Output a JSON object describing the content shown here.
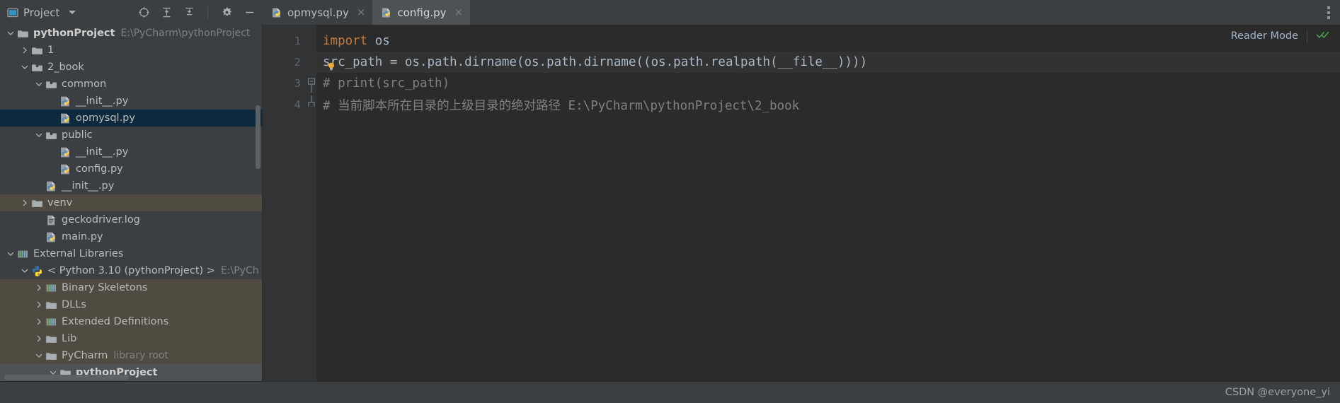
{
  "window": {
    "theme_bg": "#3c3f41",
    "editor_bg": "#2b2b2b",
    "accent_selection": "#0d293e",
    "library_bg": "#4f4b41"
  },
  "tool_window": {
    "title": "Project",
    "dropdown_icon": "chevron-down-icon",
    "actions": [
      {
        "name": "select-opened-file-icon",
        "tooltip": "Select Opened File"
      },
      {
        "name": "expand-all-icon",
        "tooltip": "Expand All"
      },
      {
        "name": "collapse-all-icon",
        "tooltip": "Collapse All"
      },
      {
        "name": "settings-gear-icon",
        "tooltip": "Settings"
      },
      {
        "name": "hide-icon",
        "tooltip": "Hide"
      }
    ]
  },
  "editor_tabs": [
    {
      "label": "opmysql.py",
      "icon": "python-file-icon",
      "active": false,
      "close_glyph": "×"
    },
    {
      "label": "config.py",
      "icon": "python-file-icon",
      "active": true,
      "close_glyph": "×"
    }
  ],
  "tabs_overflow_icon": "kebab-menu-icon",
  "reader_mode": {
    "label": "Reader Mode",
    "check_icon": "double-check-icon",
    "check_color": "#4e9a51"
  },
  "tree": [
    {
      "depth": 0,
      "arrow": "down",
      "icon": "folder-project",
      "label": "pythonProject",
      "sub": "E:\\PyCharm\\pythonProject",
      "bold": true,
      "state": "none"
    },
    {
      "depth": 1,
      "arrow": "right",
      "icon": "folder",
      "label": "1",
      "sub": "",
      "bold": false,
      "state": "none"
    },
    {
      "depth": 1,
      "arrow": "down",
      "icon": "folder-source",
      "label": "2_book",
      "sub": "",
      "bold": false,
      "state": "none"
    },
    {
      "depth": 2,
      "arrow": "down",
      "icon": "folder-source",
      "label": "common",
      "sub": "",
      "bold": false,
      "state": "none"
    },
    {
      "depth": 3,
      "arrow": "none",
      "icon": "python-file",
      "label": "__init__.py",
      "sub": "",
      "bold": false,
      "state": "none"
    },
    {
      "depth": 3,
      "arrow": "none",
      "icon": "python-file",
      "label": "opmysql.py",
      "sub": "",
      "bold": false,
      "state": "selected"
    },
    {
      "depth": 2,
      "arrow": "down",
      "icon": "folder-source",
      "label": "public",
      "sub": "",
      "bold": false,
      "state": "none"
    },
    {
      "depth": 3,
      "arrow": "none",
      "icon": "python-file",
      "label": "__init__.py",
      "sub": "",
      "bold": false,
      "state": "none"
    },
    {
      "depth": 3,
      "arrow": "none",
      "icon": "python-file",
      "label": "config.py",
      "sub": "",
      "bold": false,
      "state": "none"
    },
    {
      "depth": 2,
      "arrow": "none",
      "icon": "python-file",
      "label": "__init__.py",
      "sub": "",
      "bold": false,
      "state": "none"
    },
    {
      "depth": 1,
      "arrow": "right",
      "icon": "folder",
      "label": "venv",
      "sub": "",
      "bold": false,
      "state": "library"
    },
    {
      "depth": 2,
      "arrow": "none",
      "icon": "log-file",
      "label": "geckodriver.log",
      "sub": "",
      "bold": false,
      "state": "none"
    },
    {
      "depth": 2,
      "arrow": "none",
      "icon": "python-file",
      "label": "main.py",
      "sub": "",
      "bold": false,
      "state": "none"
    },
    {
      "depth": 0,
      "arrow": "down",
      "icon": "library-bars",
      "label": "External Libraries",
      "sub": "",
      "bold": false,
      "state": "none"
    },
    {
      "depth": 1,
      "arrow": "down",
      "icon": "python-logo",
      "label": "< Python 3.10 (pythonProject) >",
      "sub": "E:\\PyCh",
      "bold": false,
      "state": "none"
    },
    {
      "depth": 2,
      "arrow": "right",
      "icon": "library-bars",
      "label": "Binary Skeletons",
      "sub": "",
      "bold": false,
      "state": "library"
    },
    {
      "depth": 2,
      "arrow": "right",
      "icon": "folder",
      "label": "DLLs",
      "sub": "",
      "bold": false,
      "state": "library"
    },
    {
      "depth": 2,
      "arrow": "right",
      "icon": "library-bars",
      "label": "Extended Definitions",
      "sub": "",
      "bold": false,
      "state": "library"
    },
    {
      "depth": 2,
      "arrow": "right",
      "icon": "folder",
      "label": "Lib",
      "sub": "",
      "bold": false,
      "state": "library"
    },
    {
      "depth": 2,
      "arrow": "down",
      "icon": "folder",
      "label": "PyCharm",
      "sub": "library root",
      "bold": false,
      "state": "library"
    },
    {
      "depth": 3,
      "arrow": "down",
      "icon": "folder",
      "label": "pythonProject",
      "sub": "",
      "bold": true,
      "state": "grey"
    }
  ],
  "code": {
    "file": "config.py",
    "lines": [
      {
        "number": "1",
        "fold": "none",
        "caret": false,
        "tokens": [
          {
            "text": "import",
            "cls": "kw"
          },
          {
            "text": " os",
            "cls": "txt"
          }
        ]
      },
      {
        "number": "2",
        "fold": "none",
        "caret": true,
        "tokens": [
          {
            "text": "src_path = os.path.dirname(os.path.dirname((os.path.realpath(__file__))))",
            "cls": "txt"
          }
        ]
      },
      {
        "number": "3",
        "fold": "start",
        "caret": false,
        "tokens": [
          {
            "text": "# print(src_path)",
            "cls": "cmt"
          }
        ]
      },
      {
        "number": "4",
        "fold": "end",
        "caret": false,
        "tokens": [
          {
            "text": "# 当前脚本所在目录的上级目录的绝对路径 E:\\PyCharm\\pythonProject\\2_book",
            "cls": "cmt"
          }
        ]
      }
    ],
    "intention_bulb_icon": "lightbulb-icon"
  },
  "status_bar": {
    "watermark": "CSDN @everyone_yi"
  }
}
